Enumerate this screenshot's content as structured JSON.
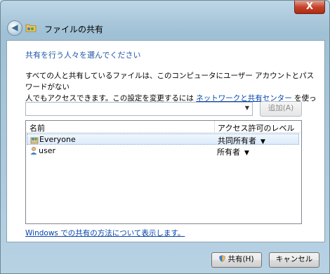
{
  "window": {
    "title": "ファイルの共有",
    "close_glyph": "X",
    "back_glyph": "◀"
  },
  "content": {
    "heading": "共有を行う人々を選んでください",
    "desc_line1": "すべての人と共有しているファイルは、このコンピュータにユーザー アカウントとパスワードがない",
    "desc_line2_prefix": "人でもアクセスできます。この設定を変更するには ",
    "desc_link": "ネットワークと共有センター",
    "desc_line2_suffix": " を使ってください。",
    "combo_value": "",
    "combo_arrow": "▼",
    "add_button": "追加(A)"
  },
  "list": {
    "headers": {
      "name": "名前",
      "level": "アクセス許可のレベル"
    },
    "rows": [
      {
        "name": "Everyone",
        "permission": "共同所有者",
        "arrow": "▼",
        "selected": true
      },
      {
        "name": "user",
        "permission": "所有者",
        "arrow": "▼",
        "selected": false
      }
    ]
  },
  "help_link": "Windows での共有の方法について表示します。",
  "buttons": {
    "share": "共有(H)",
    "cancel": "キャンセル"
  },
  "icons": {
    "title": "folder-share-icon",
    "back": "back-arrow-icon",
    "row_group": "user-group-icon",
    "row_user": "user-icon",
    "shield": "uac-shield-icon"
  },
  "colors": {
    "heading": "#1f55a8",
    "link": "#0645ad",
    "close": "#c5432a"
  }
}
